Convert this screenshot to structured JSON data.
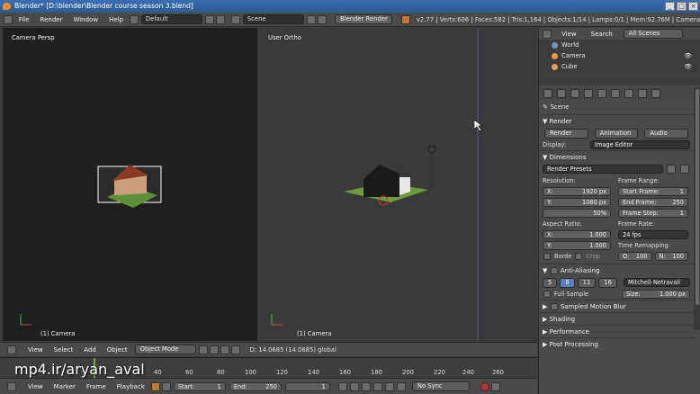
{
  "window": {
    "title": "Blender* [D:\\blender\\Blender course season 3.blend]"
  },
  "menubar": {
    "menus": [
      "File",
      "Render",
      "Window",
      "Help"
    ],
    "layout": "Default",
    "scene": "Scene",
    "engine": "Blender Render",
    "stats": "v2.77 | Verts:606 | Faces:582 | Tris:1,164 | Objects:1/14 | Lamps:0/1 | Mem:92.76M | Camera"
  },
  "viewport_left": {
    "label": "Camera Persp",
    "object": "(1) Camera"
  },
  "viewport_right": {
    "label": "User Ortho",
    "object": "(1) Camera",
    "status": "D: 14.0685 (14.0685) global"
  },
  "vp_header": {
    "items": [
      "View",
      "Select",
      "Add",
      "Object"
    ],
    "mode": "Object Mode"
  },
  "timeline": {
    "ticks": [
      "40",
      "60",
      "80",
      "100",
      "120",
      "140",
      "160",
      "180",
      "200",
      "220",
      "240",
      "260"
    ],
    "menus": [
      "View",
      "Marker",
      "Frame",
      "Playback"
    ],
    "start_label": "Start:",
    "start": "1",
    "end_label": "End:",
    "end": "250",
    "current": "1",
    "sync": "No Sync"
  },
  "watermark": "mp4.ir/aryan_aval",
  "outliner": {
    "menus": [
      "View",
      "Search"
    ],
    "scenes": "All Scenes",
    "items": [
      {
        "name": "World",
        "color": "#7a8fc7"
      },
      {
        "name": "Camera",
        "color": "#e39b4a"
      },
      {
        "name": "Cube",
        "color": "#e0a35b"
      }
    ]
  },
  "properties": {
    "context": "Scene",
    "render_section": "Render",
    "render_buttons": [
      "Render",
      "Animation",
      "Audio"
    ],
    "display_label": "Display:",
    "display": "Image Editor",
    "dimensions_section": "Dimensions",
    "presets": "Render Presets",
    "resolution_label": "Resolution:",
    "res_x_label": "X:",
    "res_x": "1920 px",
    "res_y_label": "Y:",
    "res_y": "1080 px",
    "res_pct": "50%",
    "frame_range_label": "Frame Range:",
    "start_frame_label": "Start Frame:",
    "start_frame": "1",
    "end_frame_label": "End Frame:",
    "end_frame": "250",
    "frame_step_label": "Frame Step:",
    "frame_step": "1",
    "aspect_label": "Aspect Ratio:",
    "asp_x_label": "X:",
    "asp_x": "1.000",
    "asp_y_label": "Y:",
    "asp_y": "1.000",
    "frame_rate_label": "Frame Rate:",
    "frame_rate": "24 fps",
    "remap_label": "Time Remapping:",
    "remap_old_label": "O:",
    "remap_old": "100",
    "remap_new_label": "N:",
    "remap_new": "100",
    "border_label": "Borde",
    "crop_label": "Crop",
    "aa_section": "Anti-Aliasing",
    "aa_samples": [
      "5",
      "8",
      "11",
      "16"
    ],
    "aa_selected": "8",
    "aa_filter": "Mitchell-Netravali",
    "full_sample": "Full Sample",
    "size_label": "Size:",
    "size": "1.000 px",
    "collapsed_sections": [
      "Sampled Motion Blur",
      "Shading",
      "Performance",
      "Post Processing"
    ]
  }
}
